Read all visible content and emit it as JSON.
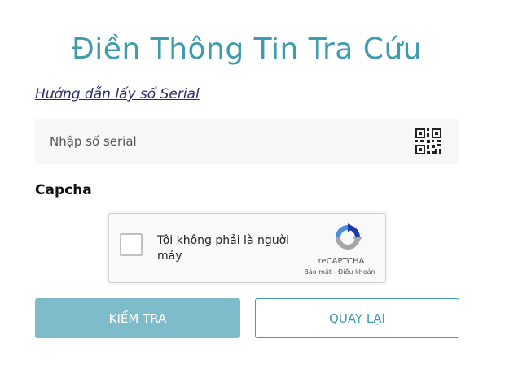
{
  "page": {
    "title": "Điền Thông Tin Tra Cứu",
    "guide_link": "Hướng dẫn lấy số Serial"
  },
  "serial": {
    "placeholder": "Nhập số serial",
    "value": "",
    "scan_icon": "qr-code-icon"
  },
  "captcha": {
    "label": "Capcha",
    "checkbox_text": "Tôi không phải là người máy",
    "brand": "reCAPTCHA",
    "links": "Bảo mật - Điều khoản",
    "checked": false,
    "logo_icon": "recaptcha-logo-icon"
  },
  "actions": {
    "check_label": "KIỂM TRA",
    "back_label": "QUAY LẠI"
  },
  "colors": {
    "accent": "#3f9bb0",
    "primary_button": "#7fbccb",
    "input_background": "#f7f7f7"
  }
}
